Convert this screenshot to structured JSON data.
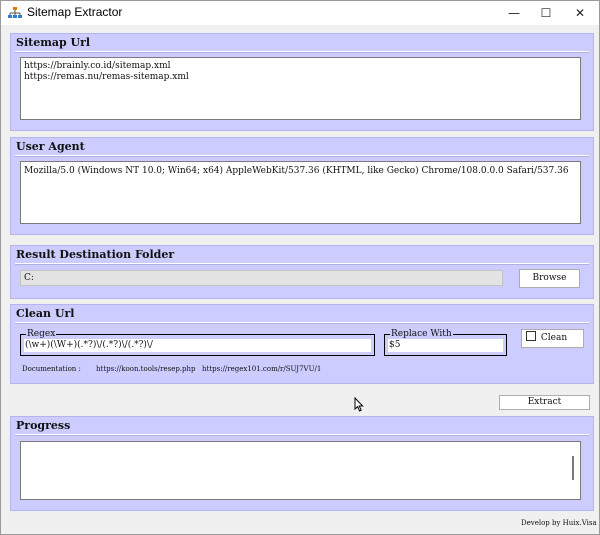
{
  "window": {
    "title": "Sitemap Extractor",
    "minimize_glyph": "—",
    "maximize_glyph": "☐",
    "close_glyph": "✕"
  },
  "sitemap": {
    "title": "Sitemap Url",
    "urls": [
      "https://brainly.co.id/sitemap.xml",
      "https://remas.nu/remas-sitemap.xml"
    ]
  },
  "user_agent": {
    "title": "User Agent",
    "value": "Mozilla/5.0 (Windows NT 10.0; Win64; x64) AppleWebKit/537.36 (KHTML, like Gecko) Chrome/108.0.0.0 Safari/537.36"
  },
  "destination": {
    "title": "Result Destination Folder",
    "path": "C:",
    "browse_label": "Browse"
  },
  "clean_url": {
    "title": "Clean Url",
    "regex_label": "Regex",
    "regex_value": "(\\w+)(\\W+)(.*?)\\/(.*?)\\/(.*?)\\/",
    "replace_label": "Replace With",
    "replace_value": "$5",
    "clean_label": "Clean",
    "clean_checked": false,
    "doc_label": "Documentation :",
    "doc_link1": "https://koon.tools/resep.php",
    "doc_link2": "https://regex101.com/r/SUJ7VU/1"
  },
  "extract_label": "Extract",
  "progress": {
    "title": "Progress",
    "log": ""
  },
  "footer": "Develop by Huix.Visa",
  "icons": {
    "app": "sitemap-tree-icon",
    "cursor": "mouse-pointer-icon"
  },
  "colors": {
    "panel": "#ccccff",
    "panel_border": "#b5b5ee",
    "window_bg": "#f0f0f0"
  }
}
